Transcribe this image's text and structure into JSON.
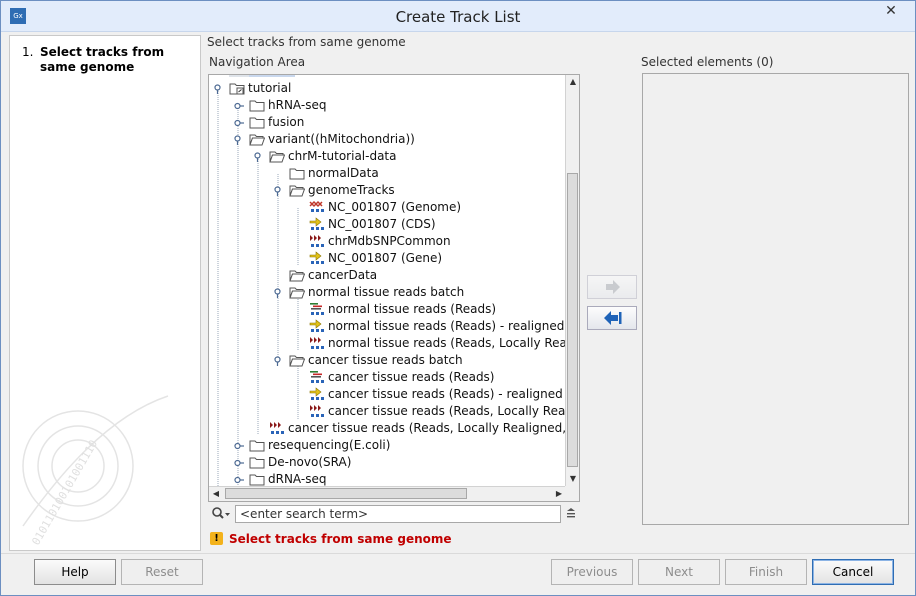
{
  "window": {
    "title": "Create Track List",
    "app_icon_text": "Gx",
    "close_glyph": "✕"
  },
  "steps": [
    {
      "number": "1.",
      "label": "Select tracks from same genome"
    }
  ],
  "content": {
    "header": "Select tracks from same genome",
    "navigation_label": "Navigation Area",
    "selected_label": "Selected elements (0)"
  },
  "tree": [
    {
      "label": "tutorial",
      "icon": "folder-data-icon",
      "toggle": "open"
    },
    {
      "label": "hRNA-seq",
      "icon": "folder-icon",
      "toggle": "closed"
    },
    {
      "label": "fusion",
      "icon": "folder-icon",
      "toggle": "closed"
    },
    {
      "label": "variant((hMitochondria))",
      "icon": "folder-open-icon",
      "toggle": "open"
    },
    {
      "label": "chrM-tutorial-data",
      "icon": "folder-open-icon",
      "toggle": "open"
    },
    {
      "label": "normalData",
      "icon": "folder-icon",
      "toggle": "none"
    },
    {
      "label": "genomeTracks",
      "icon": "folder-open-icon",
      "toggle": "open"
    },
    {
      "label": "NC_001807 (Genome)",
      "icon": "genome-track-icon",
      "toggle": "none"
    },
    {
      "label": "NC_001807 (CDS)",
      "icon": "annotation-track-icon",
      "toggle": "none"
    },
    {
      "label": "chrMdbSNPCommon",
      "icon": "variant-track-icon",
      "toggle": "none"
    },
    {
      "label": "NC_001807 (Gene)",
      "icon": "annotation-track-icon",
      "toggle": "none"
    },
    {
      "label": "cancerData",
      "icon": "folder-open-icon",
      "toggle": "none"
    },
    {
      "label": "normal tissue reads batch",
      "icon": "folder-open-icon",
      "toggle": "open"
    },
    {
      "label": "normal tissue reads (Reads)",
      "icon": "reads-track-icon",
      "toggle": "none"
    },
    {
      "label": "normal tissue reads (Reads) - realigned",
      "icon": "annotation-track-icon",
      "toggle": "none"
    },
    {
      "label": "normal tissue reads (Reads, Locally Reali",
      "icon": "variant-track-icon",
      "toggle": "none"
    },
    {
      "label": "cancer tissue reads batch",
      "icon": "folder-open-icon",
      "toggle": "open"
    },
    {
      "label": "cancer tissue reads (Reads)",
      "icon": "reads-track-icon",
      "toggle": "none"
    },
    {
      "label": "cancer tissue reads (Reads) - realigned r",
      "icon": "annotation-track-icon",
      "toggle": "none"
    },
    {
      "label": "cancer tissue reads (Reads, Locally Reali",
      "icon": "variant-track-icon",
      "toggle": "none"
    },
    {
      "label": "cancer tissue reads (Reads, Locally Realigned, V",
      "icon": "variant-track-icon",
      "toggle": "none"
    },
    {
      "label": "resequencing(E.coli)",
      "icon": "folder-icon",
      "toggle": "closed"
    },
    {
      "label": "De-novo(SRA)",
      "icon": "folder-icon",
      "toggle": "closed"
    },
    {
      "label": "dRNA-seq",
      "icon": "folder-icon",
      "toggle": "closed"
    }
  ],
  "search": {
    "value": "",
    "placeholder": "<enter search term>"
  },
  "warning": {
    "text": "Select tracks from same genome"
  },
  "buttons": {
    "help": "Help",
    "reset": "Reset",
    "previous": "Previous",
    "next": "Next",
    "finish": "Finish",
    "cancel": "Cancel"
  },
  "colors": {
    "accent": "#2f6db3",
    "warning_text": "#c00000",
    "warning_icon": "#f3b21b",
    "folder": "#d9b64a"
  }
}
